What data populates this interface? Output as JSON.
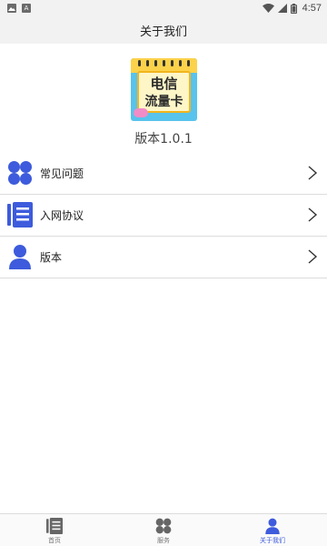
{
  "status_bar": {
    "left_icons": [
      "image-icon",
      "a-icon"
    ],
    "right_icons": [
      "wifi-icon",
      "signal-icon",
      "battery-icon"
    ],
    "time": "4:57"
  },
  "header": {
    "title": "关于我们"
  },
  "logo": {
    "line1": "电信",
    "line2": "流量卡"
  },
  "version_text": "版本1.0.1",
  "menu": {
    "items": [
      {
        "label": "常见问题",
        "icon": "grid-icon"
      },
      {
        "label": "入网协议",
        "icon": "document-icon"
      },
      {
        "label": "版本",
        "icon": "person-icon"
      }
    ]
  },
  "tabs": [
    {
      "label": "首页",
      "icon": "document-icon",
      "active": false
    },
    {
      "label": "服务",
      "icon": "grid-icon",
      "active": false
    },
    {
      "label": "关于我们",
      "icon": "person-icon",
      "active": true
    }
  ],
  "colors": {
    "accent": "#3d5bdc",
    "active_tab": "#3d5bdc",
    "inactive_tab": "#777777",
    "header_bg": "#f2f2f2"
  }
}
